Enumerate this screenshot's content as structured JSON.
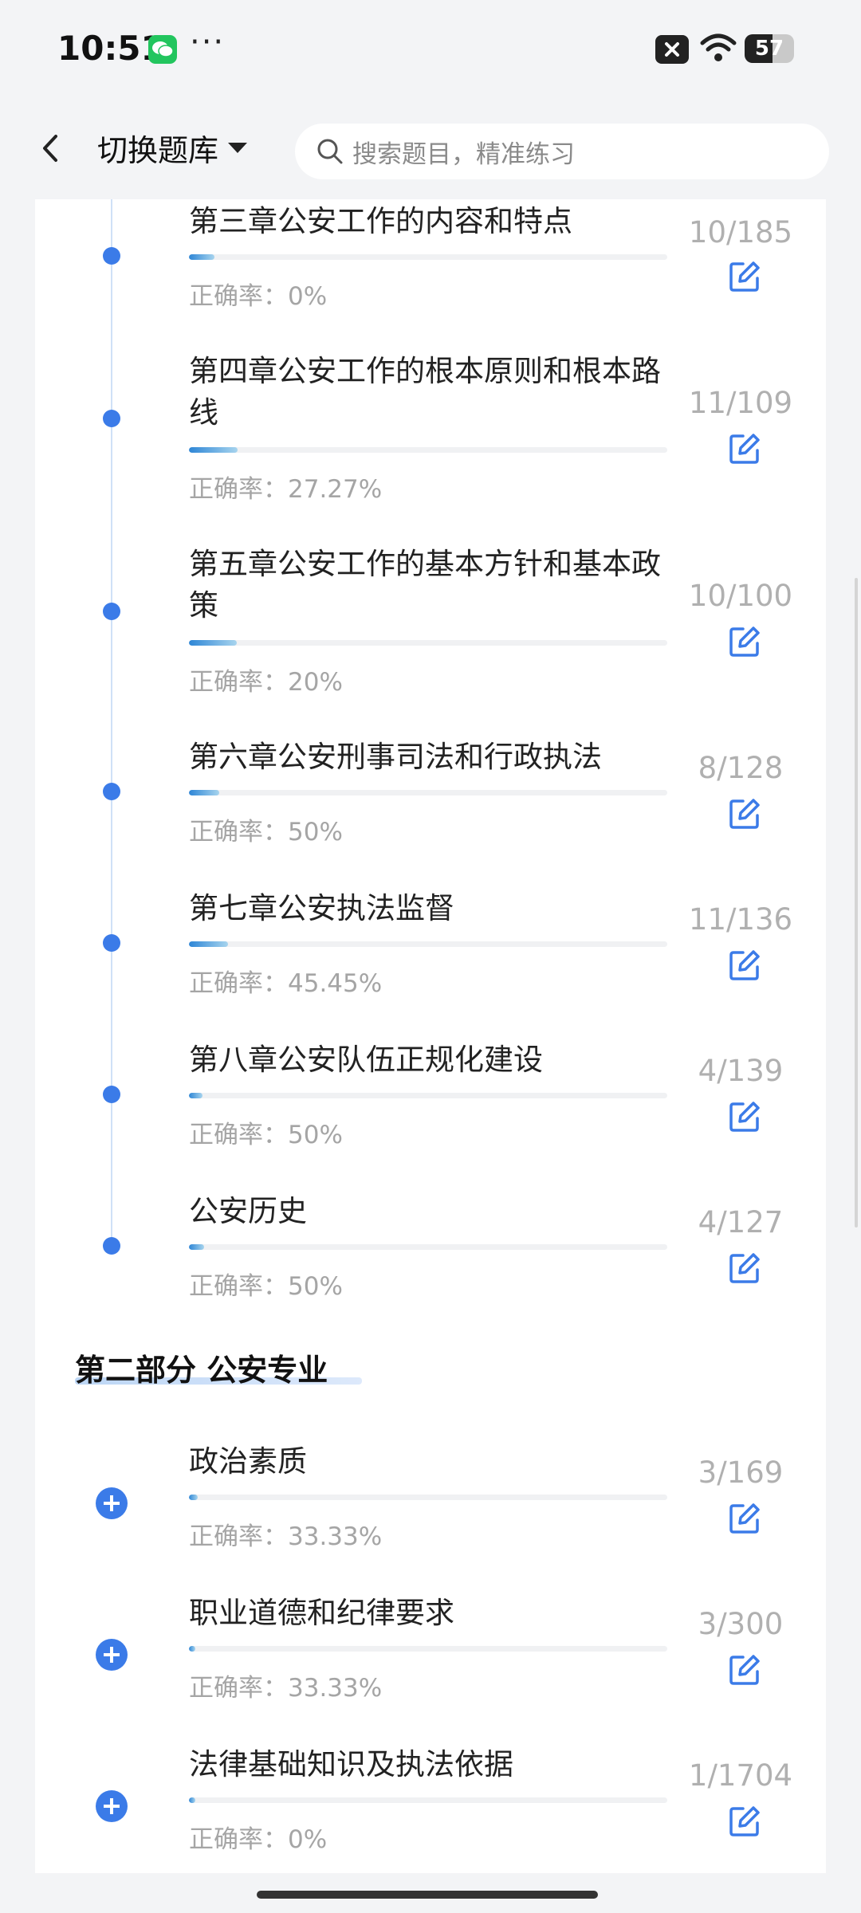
{
  "status_bar": {
    "time": "10:51",
    "dots": "···",
    "battery": "57"
  },
  "header": {
    "switch_label": "切换题库",
    "search_placeholder": "搜索题目，精准练习"
  },
  "chapters": [
    {
      "title": "第三章公安工作的内容和特点",
      "count": "10/185",
      "accuracy": "正确率：0%",
      "progress": 0.054
    },
    {
      "title": "第四章公安工作的根本原则和根本路线",
      "count": "11/109",
      "accuracy": "正确率：27.27%",
      "progress": 0.101
    },
    {
      "title": "第五章公安工作的基本方针和基本政策",
      "count": "10/100",
      "accuracy": "正确率：20%",
      "progress": 0.1
    },
    {
      "title": "第六章公安刑事司法和行政执法",
      "count": "8/128",
      "accuracy": "正确率：50%",
      "progress": 0.0625
    },
    {
      "title": "第七章公安执法监督",
      "count": "11/136",
      "accuracy": "正确率：45.45%",
      "progress": 0.081
    },
    {
      "title": "第八章公安队伍正规化建设",
      "count": "4/139",
      "accuracy": "正确率：50%",
      "progress": 0.029
    },
    {
      "title": "公安历史",
      "count": "4/127",
      "accuracy": "正确率：50%",
      "progress": 0.031
    }
  ],
  "section2": {
    "title": "第二部分 公安专业",
    "items": [
      {
        "title": "政治素质",
        "count": "3/169",
        "accuracy": "正确率：33.33%",
        "progress": 0.018
      },
      {
        "title": "职业道德和纪律要求",
        "count": "3/300",
        "accuracy": "正确率：33.33%",
        "progress": 0.01
      },
      {
        "title": "法律基础知识及执法依据",
        "count": "1/1704",
        "accuracy": "正确率：0%",
        "progress": 0.0006
      }
    ]
  }
}
